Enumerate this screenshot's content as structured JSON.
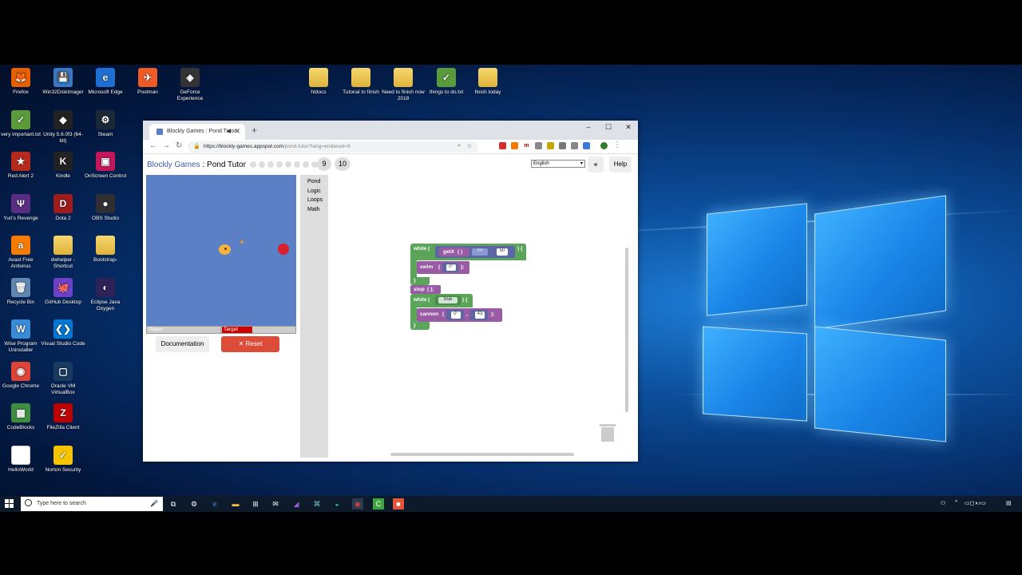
{
  "desktop_icons": [
    {
      "label": "Firefox",
      "glyph": "🦊",
      "color": "#e66000"
    },
    {
      "label": "Win32DiskImager",
      "glyph": "💾",
      "color": "#3a78c4"
    },
    {
      "label": "Microsoft Edge",
      "glyph": "e",
      "color": "#1f6fd0"
    },
    {
      "label": "Postman",
      "glyph": "✈",
      "color": "#ef5b25"
    },
    {
      "label": "GeForce Experience",
      "glyph": "◈",
      "color": "#333"
    },
    {
      "label": "very important.txt",
      "glyph": "✓",
      "color": "#5a9a3a"
    },
    {
      "label": "Unity 5.6.0f3 (64-bit)",
      "glyph": "◆",
      "color": "#222"
    },
    {
      "label": "Steam",
      "glyph": "⚙",
      "color": "#1b2838"
    },
    {
      "label": "Red Alert 2",
      "glyph": "★",
      "color": "#b52a1c"
    },
    {
      "label": "Kindle",
      "glyph": "K",
      "color": "#222"
    },
    {
      "label": "OnScreen Control",
      "glyph": "▣",
      "color": "#c2185b"
    },
    {
      "label": "Yuri's Revenge",
      "glyph": "Ψ",
      "color": "#5a2d82"
    },
    {
      "label": "Dota 2",
      "glyph": "D",
      "color": "#a01c1c"
    },
    {
      "label": "OBS Studio",
      "glyph": "●",
      "color": "#302e31"
    },
    {
      "label": "Avast Free Antivirus",
      "glyph": "a",
      "color": "#f57c00"
    },
    {
      "label": "dwhelper - Shortcut",
      "glyph": "",
      "color": "#e0b23a"
    },
    {
      "label": "Bootstrap-",
      "glyph": "",
      "color": "#e0b23a"
    },
    {
      "label": "Recycle Bin",
      "glyph": "🗑",
      "color": "#5f87b0"
    },
    {
      "label": "GitHub Desktop",
      "glyph": "🐙",
      "color": "#6e40c9"
    },
    {
      "label": "Eclipse Java Oxygen",
      "glyph": "◐",
      "color": "#2c2255"
    },
    {
      "label": "Wise Program Uninstaller",
      "glyph": "W",
      "color": "#3a8ad8"
    },
    {
      "label": "Visual Studio Code",
      "glyph": "❮❯",
      "color": "#0078d4"
    },
    {
      "label": "Google Chrome",
      "glyph": "◉",
      "color": "#db4437"
    },
    {
      "label": "Oracle VM VirtualBox",
      "glyph": "▢",
      "color": "#183a61"
    },
    {
      "label": "CodeBlocks",
      "glyph": "▦",
      "color": "#3e8e41"
    },
    {
      "label": "FileZilla Client",
      "glyph": "Z",
      "color": "#bf0000"
    },
    {
      "label": "HelloWorld",
      "glyph": "",
      "color": "#fff"
    },
    {
      "label": "Norton Security",
      "glyph": "✓",
      "color": "#f5c400"
    },
    {
      "label": "htdocs",
      "glyph": "",
      "color": "#e0b23a"
    },
    {
      "label": "Tutorial to finish",
      "glyph": "",
      "color": "#e0b23a"
    },
    {
      "label": "Need to finish now 2018",
      "glyph": "",
      "color": "#e0b23a"
    },
    {
      "label": "things to do.txt",
      "glyph": "✓",
      "color": "#5a9a3a"
    },
    {
      "label": "finish today",
      "glyph": "",
      "color": "#e0b23a"
    }
  ],
  "browser": {
    "tab_title": "Blockly Games : Pond Tutor",
    "tab_close": "✕",
    "tab_audio": "◀",
    "new_tab": "+",
    "url_host": "https://blockly-games.appspot.com",
    "url_path": "/pond-tutor?lang=en&level=9",
    "back": "←",
    "forward": "→",
    "reload": "↻",
    "minimize": "–",
    "maximize": "☐",
    "close": "✕"
  },
  "page": {
    "brand": "Blockly Games",
    "separator": " : ",
    "title": "Pond Tutor",
    "levels": [
      "9",
      "10"
    ],
    "language": "English",
    "link_glyph": "⚭",
    "help": "Help",
    "player_label": "Player",
    "target_label": "Target",
    "documentation": "Documentation",
    "reset": "Reset",
    "reset_glyph": "✕"
  },
  "categories": [
    "Pond",
    "Logic",
    "Loops",
    "Math"
  ],
  "blocks": {
    "while1": "while (",
    "getx": "getX",
    "getx_parens": "( )",
    "op": "<=",
    "num50": "50",
    "close_brace_open": ") {",
    "swim": "swim",
    "swim_open": "(",
    "deg0": "0°",
    "swim_close": ");",
    "brace_close": "}",
    "stop": "stop",
    "stop_call": "( );",
    "while2": "while (",
    "true": "true",
    "cannon": "cannon",
    "cannon_open": "(",
    "cannon_deg": "0°",
    "comma": ",",
    "num43": "43",
    "cannon_close": ");"
  },
  "taskbar": {
    "search_placeholder": "Type here to search",
    "mic": "🎤"
  },
  "colors": {
    "logic_green": "#5ba55b",
    "pond_purple": "#9a5ba5",
    "math_blue": "#5b67a5",
    "reset_red": "#dd4b39",
    "arena_blue": "#5b80c5"
  }
}
